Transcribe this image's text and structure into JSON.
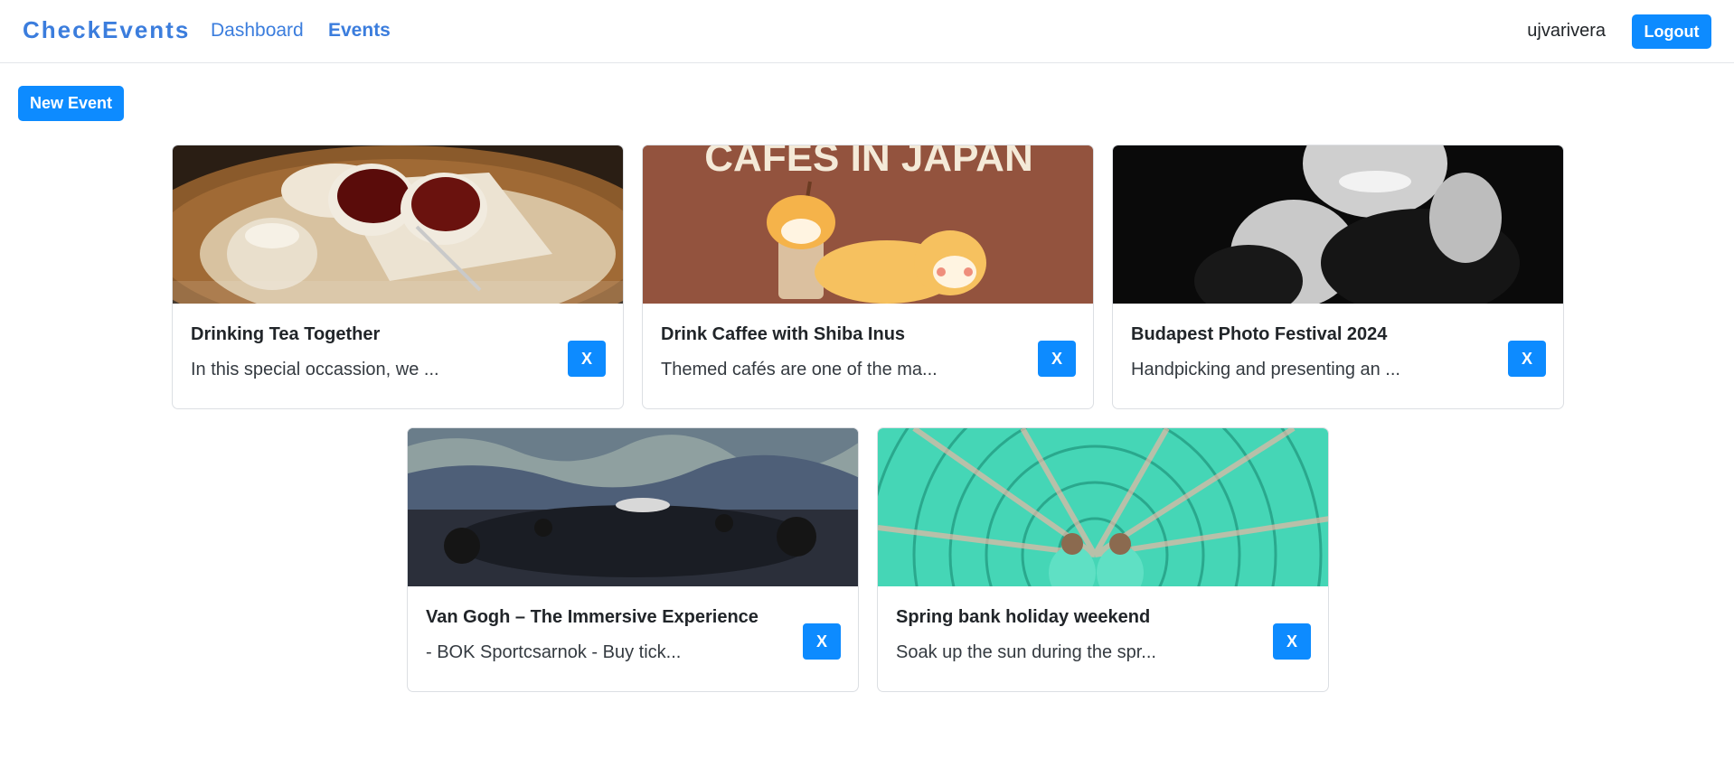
{
  "navbar": {
    "brand": "CheckEvents",
    "links": [
      "Dashboard",
      "Events"
    ],
    "username": "ujvarivera",
    "logout_label": "Logout"
  },
  "actions": {
    "new_event_label": "New Event"
  },
  "events": [
    {
      "title": "Drinking Tea Together",
      "excerpt": "In this special occassion, we ...",
      "delete_label": "X"
    },
    {
      "title": "Drink Caffee with Shiba Inus",
      "excerpt": "Themed cafés are one of the ma...",
      "delete_label": "X",
      "image_text": "CAFES IN JAPAN"
    },
    {
      "title": "Budapest Photo Festival 2024",
      "excerpt": "Handpicking and presenting an ...",
      "delete_label": "X"
    },
    {
      "title": "Van Gogh – The Immersive Experience",
      "excerpt": "- BOK Sportcsarnok - Buy tick...",
      "delete_label": "X"
    },
    {
      "title": "Spring bank holiday weekend",
      "excerpt": "Soak up the sun during the spr...",
      "delete_label": "X"
    }
  ],
  "colors": {
    "primary": "#0d8bff",
    "brand": "#3b7ddd"
  }
}
